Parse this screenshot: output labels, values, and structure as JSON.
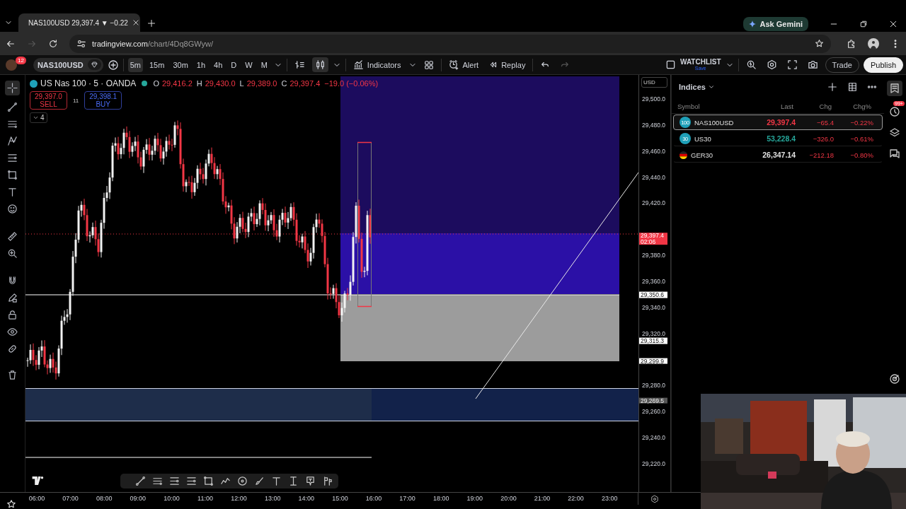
{
  "browser": {
    "tab_title": "NAS100USD 29,397.4 ▼ −0.22",
    "ask_button": "Ask Gemini",
    "url_host": "tradingview.com",
    "url_path": "/chart/4Dq8GWyw/"
  },
  "toolbar": {
    "notification_count": "12",
    "symbol": "NAS100USD",
    "intervals": [
      {
        "label": "5m",
        "selected": true
      },
      {
        "label": "15m",
        "selected": false
      },
      {
        "label": "30m",
        "selected": false
      },
      {
        "label": "1h",
        "selected": false
      },
      {
        "label": "4h",
        "selected": false
      },
      {
        "label": "D",
        "selected": false
      },
      {
        "label": "W",
        "selected": false
      },
      {
        "label": "M",
        "selected": false
      }
    ],
    "indicators": "Indicators",
    "alert": "Alert",
    "replay": "Replay",
    "watchlist_name": "WATCHLIST",
    "watchlist_status": "Save",
    "trade": "Trade",
    "publish": "Publish"
  },
  "legend": {
    "title": "US Nas 100 · 5 · OANDA",
    "ohlc": [
      {
        "key": "O",
        "value": "29,416.2"
      },
      {
        "key": "H",
        "value": "29,430.0"
      },
      {
        "key": "L",
        "value": "29,389.0"
      },
      {
        "key": "C",
        "value": "29,397.4"
      }
    ],
    "change": "−19.0 (−0.06%)",
    "sell_price": "29,397.0",
    "sell_label": "SELL",
    "spread": "11",
    "buy_price": "29,398.1",
    "buy_label": "BUY",
    "collapsed_count": "4"
  },
  "price_axis": {
    "currency": "USD",
    "ticks": [
      "29,500.0",
      "29,480.0",
      "29,460.0",
      "29,440.0",
      "29,420.0",
      "29,380.0",
      "29,360.0",
      "29,340.0",
      "29,320.0",
      "29,280.0",
      "29,260.0",
      "29,240.0",
      "29,220.0"
    ],
    "labels": [
      {
        "value": "29,397.4",
        "countdown": "02:06",
        "kind": "last"
      },
      {
        "value": "29,350.6",
        "kind": "line"
      },
      {
        "value": "29,315.3",
        "kind": "line"
      },
      {
        "value": "29,299.9",
        "kind": "line"
      },
      {
        "value": "29,269.5",
        "kind": "band"
      }
    ]
  },
  "time_axis": {
    "ticks": [
      "06:00",
      "07:00",
      "08:00",
      "09:00",
      "10:00",
      "11:00",
      "12:00",
      "13:00",
      "14:00",
      "15:00",
      "16:00",
      "17:00",
      "18:00",
      "19:00",
      "20:00",
      "21:00",
      "22:00",
      "23:00"
    ]
  },
  "watchlist": {
    "title": "Indices",
    "columns": [
      "Symbol",
      "Last",
      "Chg",
      "Chg%"
    ],
    "alerts_badge": "99+",
    "rows": [
      {
        "symbol": "NAS100USD",
        "kind": "badge",
        "badge": "100",
        "last": "29,397.4",
        "color": "#f23645",
        "chg": "−65.4",
        "chg_pct": "−0.22%",
        "selected": true
      },
      {
        "symbol": "US30",
        "kind": "badge",
        "badge": "30",
        "last": "53,228.4",
        "color": "#26a69a",
        "chg": "−326.0",
        "chg_pct": "−0.61%",
        "selected": false
      },
      {
        "symbol": "GER30",
        "kind": "flag",
        "last": "26,347.14",
        "color": "#e0e0e0",
        "chg": "−212.18",
        "chg_pct": "−0.80%",
        "selected": false
      }
    ]
  }
}
